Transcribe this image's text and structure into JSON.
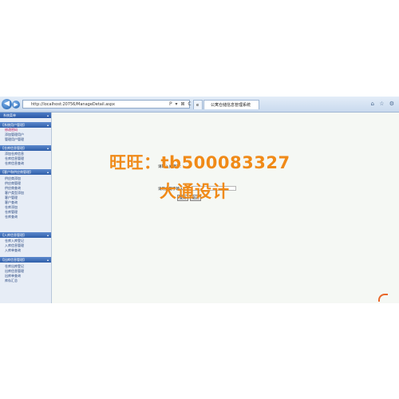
{
  "browser": {
    "address": "http://localhost:20756/ManageDetail.aspx",
    "address_icons": "P ▾ ⊠ C ✕",
    "tab_inactive": "e",
    "tab_active": "公寓仓储信息管理系统",
    "toolbar_right_icons": "⌂ ☆ ⚙"
  },
  "sidebar": {
    "header": "系统菜单",
    "groups": [
      {
        "label": "【系统用户管理】",
        "items": [
          "修改密码",
          "添加管理用户",
          "管理用户管理"
        ]
      },
      {
        "label": "【仓库信息管理】",
        "items": [
          "添加仓库信息",
          "仓库信息管理",
          "仓库信息查询"
        ]
      },
      {
        "label": "【客户和供应商管理】",
        "items": [
          "供应商添加",
          "供应商管理",
          "供应商查询",
          "客户类型添加",
          "客户管理",
          "客户查询",
          "仓库添加",
          "仓库管理",
          "仓库查询"
        ]
      },
      {
        "label": "【入库信息管理】",
        "items": [
          "仓库入库登记",
          "入库信息管理",
          "入库单查询"
        ]
      },
      {
        "label": "【出库信息管理】",
        "items": [
          "仓库出库登记",
          "出库信息管理",
          "出库单查询",
          "库存汇总"
        ]
      }
    ]
  },
  "form": {
    "label_type": "请输入关键字：",
    "label_keyword": "请用关键字输入：",
    "button_search": "查询",
    "button_reset": "取消"
  },
  "watermark": {
    "line1": "旺旺：tb500083327",
    "line2": "大通设计"
  }
}
